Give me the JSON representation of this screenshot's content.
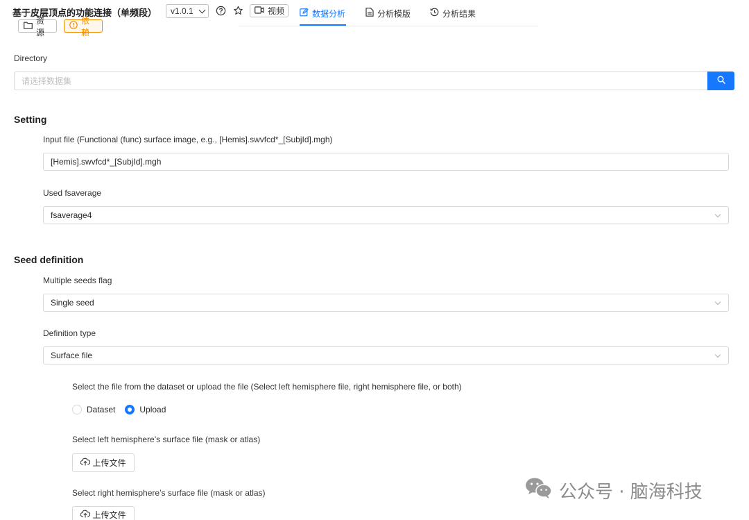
{
  "header": {
    "title": "基于皮层顶点的功能连接（单频段）",
    "version": "v1.0.1",
    "video_label": "视频",
    "resources_label": "资源",
    "dependencies_label": "依赖"
  },
  "tabs": [
    {
      "label": "数据分析",
      "active": true
    },
    {
      "label": "分析模版",
      "active": false
    },
    {
      "label": "分析结果",
      "active": false
    }
  ],
  "directory": {
    "label": "Directory",
    "placeholder": "请选择数据集"
  },
  "setting": {
    "title": "Setting",
    "input_file_label": "Input file (Functional (func) surface image, e.g., [Hemis].swvfcd*_[SubjId].mgh)",
    "input_file_value": "[Hemis].swvfcd*_[SubjId].mgh",
    "fsaverage_label": "Used fsaverage",
    "fsaverage_value": "fsaverage4"
  },
  "seed": {
    "title": "Seed definition",
    "multiple_label": "Multiple seeds flag",
    "multiple_value": "Single seed",
    "definition_label": "Definition type",
    "definition_value": "Surface file",
    "select_source_label": "Select the file from the dataset or upload the file (Select left hemisphere file, right hemisphere file, or both)",
    "radio_options": [
      {
        "label": "Dataset",
        "checked": false
      },
      {
        "label": "Upload",
        "checked": true
      }
    ],
    "left_label": "Select left hemisphere’s surface file (mask or atlas)",
    "right_label": "Select right hemisphere’s surface file (mask or atlas)",
    "upload_label": "上传文件"
  },
  "watermark": "公众号 · 脑海科技",
  "colors": {
    "accent": "#1677ff",
    "warning": "#f08c00",
    "border": "#d9d9d9"
  }
}
